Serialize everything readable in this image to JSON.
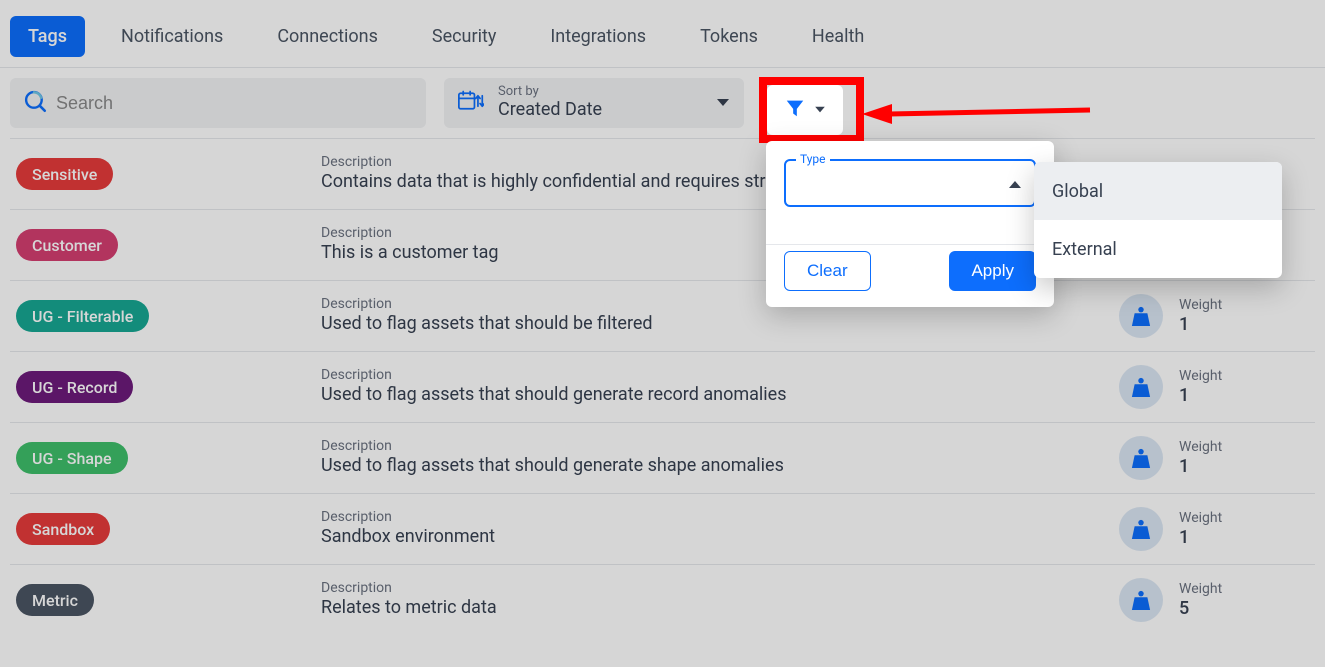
{
  "tabs": [
    {
      "label": "Tags",
      "active": true
    },
    {
      "label": "Notifications",
      "active": false
    },
    {
      "label": "Connections",
      "active": false
    },
    {
      "label": "Security",
      "active": false
    },
    {
      "label": "Integrations",
      "active": false
    },
    {
      "label": "Tokens",
      "active": false
    },
    {
      "label": "Health",
      "active": false
    }
  ],
  "search": {
    "placeholder": "Search",
    "value": ""
  },
  "sort": {
    "label": "Sort by",
    "value": "Created Date"
  },
  "filter": {
    "type_label": "Type",
    "clear_label": "Clear",
    "apply_label": "Apply",
    "options": [
      {
        "label": "Global",
        "hover": true
      },
      {
        "label": "External",
        "hover": false
      }
    ]
  },
  "columns": {
    "description": "Description",
    "weight": "Weight"
  },
  "rows": [
    {
      "tag": "Sensitive",
      "color": "#e63b3b",
      "text_dark": false,
      "description": "Contains data that is highly confidential and requires strict access controls",
      "weight": null
    },
    {
      "tag": "Customer",
      "color": "#d53e71",
      "text_dark": false,
      "description": "This is a customer tag",
      "weight": null
    },
    {
      "tag": "UG - Filterable",
      "color": "#17a793",
      "text_dark": false,
      "description": "Used to flag assets that should be filtered",
      "weight": "1"
    },
    {
      "tag": "UG - Record",
      "color": "#6d1b7b",
      "text_dark": false,
      "description": "Used to flag assets that should generate record anomalies",
      "weight": "1"
    },
    {
      "tag": "UG - Shape",
      "color": "#3fbf6b",
      "text_dark": false,
      "description": "Used to flag assets that should generate shape anomalies",
      "weight": "1"
    },
    {
      "tag": "Sandbox",
      "color": "#e63b3b",
      "text_dark": false,
      "description": "Sandbox environment",
      "weight": "1"
    },
    {
      "tag": "Metric",
      "color": "#4b5563",
      "text_dark": false,
      "description": "Relates to metric data",
      "weight": "5"
    }
  ]
}
